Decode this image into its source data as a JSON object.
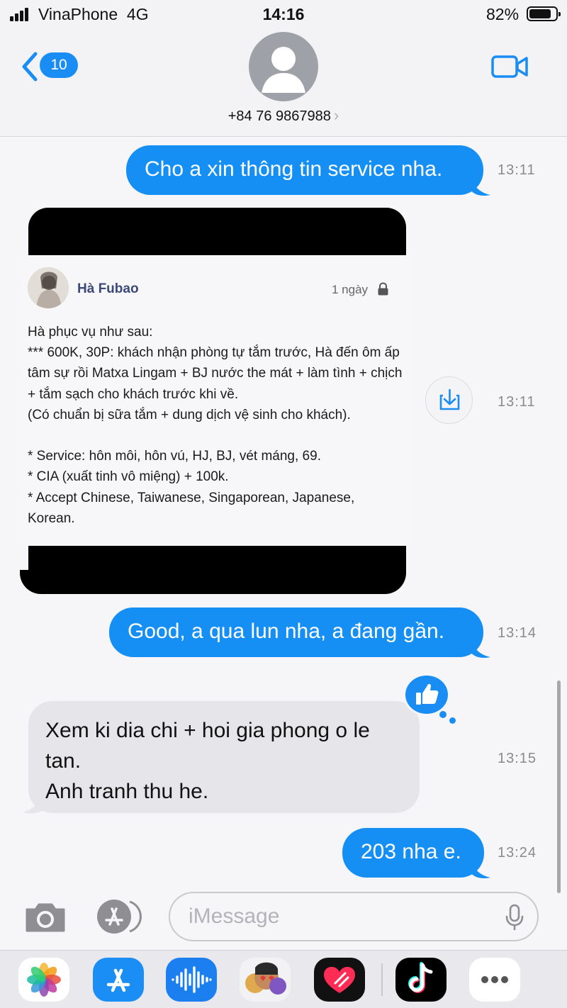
{
  "status_bar": {
    "carrier": "VinaPhone",
    "network": "4G",
    "time": "14:16",
    "battery_percent": "82%",
    "battery_level": 0.82
  },
  "header": {
    "back_badge": "10",
    "contact_phone": "+84 76 9867988"
  },
  "messages": [
    {
      "direction": "out",
      "text": "Cho a xin thông tin service nha.",
      "time": "13:11"
    },
    {
      "direction": "in",
      "kind": "screenshot",
      "time": "13:11",
      "screenshot": {
        "name": "Hà Fubao",
        "age": "1 ngày",
        "body": "Hà phục vụ như sau:\n*** 600K, 30P: khách nhận phòng tự tắm trước, Hà đến ôm ấp tâm sự rồi Matxa Lingam + BJ nước the mát + làm tình + chịch + tắm sạch cho khách trước khi về.\n(Có chuẩn bị sữa tắm + dung dịch vệ sinh cho khách).\n\n* Service: hôn môi, hôn vú, HJ, BJ, vét máng, 69.\n* CIA (xuất tinh vô miệng) + 100k.\n* Accept Chinese, Taiwanese, Singaporean, Japanese, Korean."
      }
    },
    {
      "direction": "out",
      "text": "Good, a qua lun nha, a đang gần.",
      "time": "13:14"
    },
    {
      "direction": "in",
      "lines": [
        "Xem ki dia chi + hoi gia phong o le",
        "tan.",
        "Anh tranh thu he."
      ],
      "time": "13:15",
      "tapback": "thumbs-up"
    },
    {
      "direction": "out",
      "text": "203 nha e.",
      "time": "13:24"
    }
  ],
  "compose": {
    "placeholder": "iMessage"
  },
  "app_drawer": [
    "photos",
    "app-store",
    "audio-messages",
    "memoji",
    "digital-touch",
    "tiktok",
    "more"
  ],
  "colors": {
    "accent": "#168ff4",
    "incoming_bubble": "#e6e6ea",
    "background": "#f6f6f8",
    "timestamp": "#8a8a8e"
  }
}
